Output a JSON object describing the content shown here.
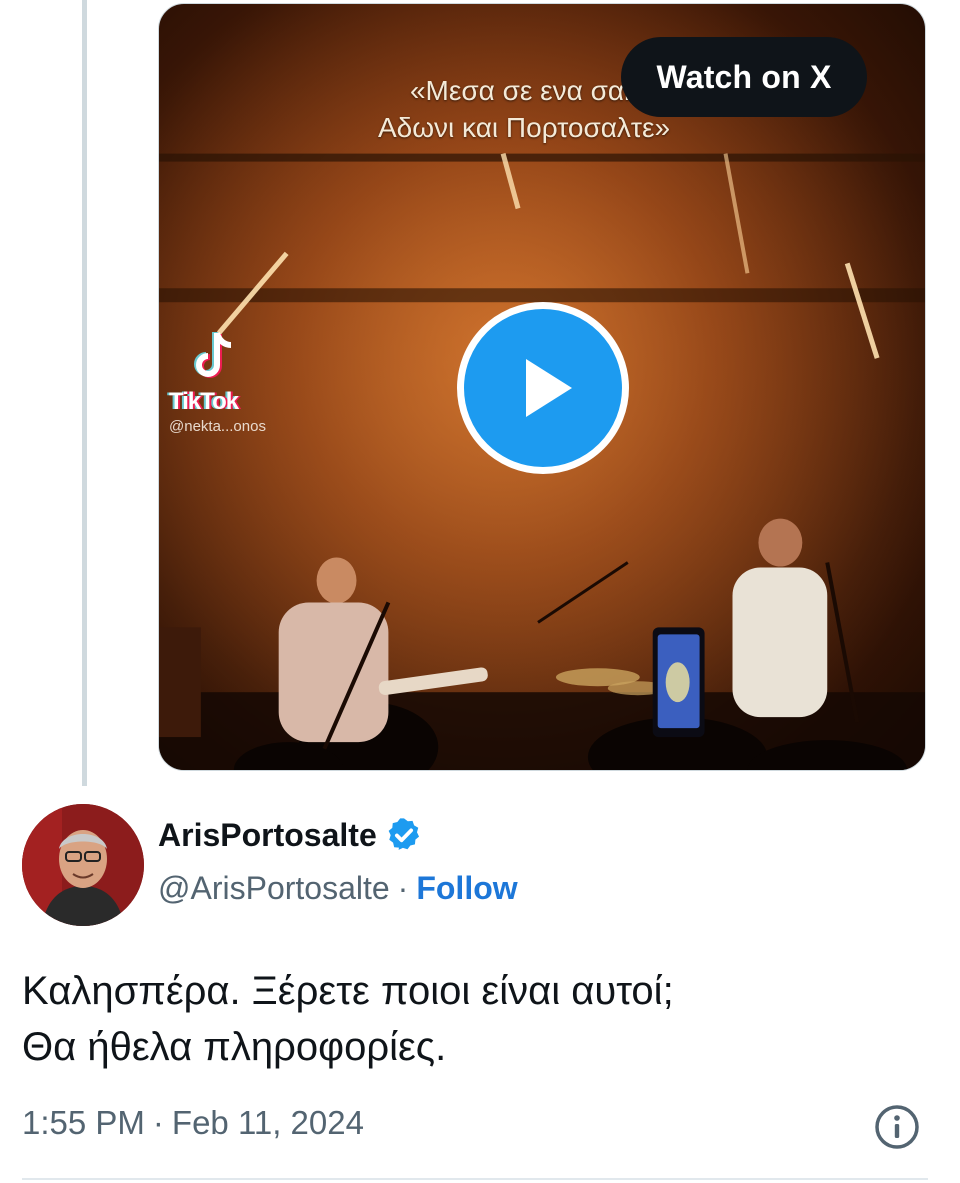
{
  "media": {
    "caption_line1": "«Μεσα σε ενα σακ",
    "caption_line2": "Αδωνι και Πορτοσαλτε»",
    "watch_label": "Watch on X",
    "watermark_name": "TikTok",
    "watermark_handle": "@nekta...onos",
    "play_icon": "play-icon"
  },
  "author": {
    "display_name": "ArisPortosalte",
    "handle": "@ArisPortosalte",
    "separator": "·",
    "follow_label": "Follow",
    "verified_icon": "verified-badge-icon"
  },
  "tweet": {
    "line1": "Καλησπέρα. Ξέρετε ποιοι είναι αυτοί;",
    "line2": "Θα ήθελα πληροφορίες.",
    "time": "1:55 PM",
    "separator": "·",
    "date": "Feb 11, 2024",
    "info_icon": "info-icon"
  },
  "colors": {
    "accent": "#1d9bf0",
    "follow": "#1d77d8",
    "text": "#0f1419",
    "muted": "#536471"
  }
}
